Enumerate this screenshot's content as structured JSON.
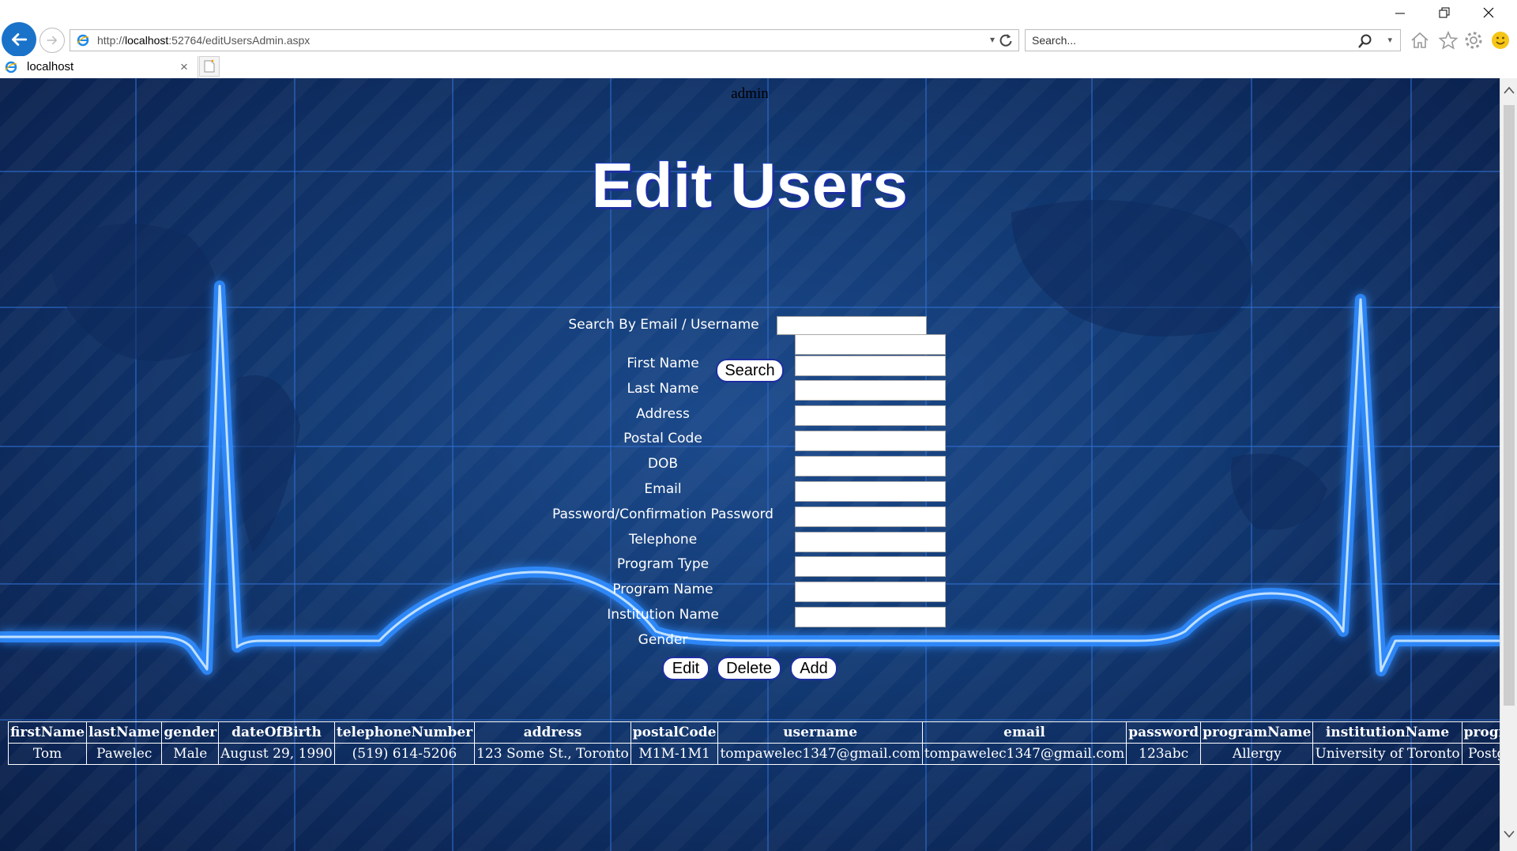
{
  "browser": {
    "url_prefix": "http://",
    "url_host": "localhost",
    "url_rest": ":52764/editUsersAdmin.aspx",
    "search_placeholder": "Search...",
    "tab_title": "localhost",
    "tab_close": "×"
  },
  "page": {
    "user_label": "admin",
    "title": "Edit Users",
    "search_label": "Search By Email / Username",
    "search_value": "",
    "search_button": "Search",
    "fields": [
      {
        "label": "First Name",
        "value": ""
      },
      {
        "label": "Last Name",
        "value": ""
      },
      {
        "label": "Address",
        "value": ""
      },
      {
        "label": "Postal Code",
        "value": ""
      },
      {
        "label": "DOB",
        "value": ""
      },
      {
        "label": "Email",
        "value": ""
      },
      {
        "label": "Password/Confirmation Password",
        "value": ""
      },
      {
        "label": "Telephone",
        "value": ""
      },
      {
        "label": "Program Type",
        "value": ""
      },
      {
        "label": "Program Name",
        "value": ""
      },
      {
        "label": "Institution Name",
        "value": ""
      },
      {
        "label": "Gender",
        "value": ""
      }
    ],
    "buttons": {
      "edit": "Edit",
      "delete": "Delete",
      "add": "Add"
    }
  },
  "table": {
    "columns": [
      "firstName",
      "lastName",
      "gender",
      "dateOfBirth",
      "telephoneNumber",
      "address",
      "postalCode",
      "username",
      "email",
      "password",
      "programName",
      "institutionName",
      "programType"
    ],
    "rows": [
      [
        "Tom",
        "Pawelec",
        "Male",
        "August 29, 1990",
        "(519) 614-5206",
        "123 Some St., Toronto",
        "M1M-1M1",
        "tompawelec1347@gmail.com",
        "tompawelec1347@gmail.com",
        "123abc",
        "Allergy",
        "University of Toronto",
        "Postgraduate"
      ]
    ]
  },
  "colors": {
    "accent": "#1a73c9",
    "page_bg": "#123a74",
    "pulse": "#3a9bff",
    "title_shadow": "#1d2fa0"
  }
}
